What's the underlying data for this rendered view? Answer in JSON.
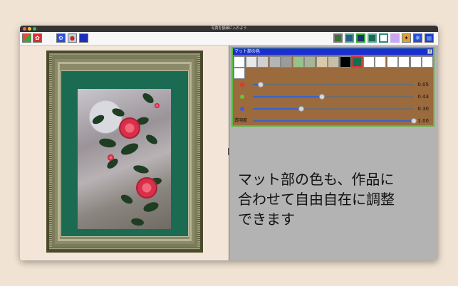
{
  "window": {
    "title": "写真を額縁に入れよう"
  },
  "toolbar": {
    "left_icons": [
      "photo-collage-icon",
      "camellia-icon",
      "gear-icon",
      "ladybug-jar-icon",
      "frame-blue-icon"
    ],
    "right_icons": [
      "frame-green-icon",
      "frame-blue-square-icon",
      "frame-navy-icon",
      "frame-teal-icon",
      "frame-outline-icon",
      "lavender-swatch-icon",
      "star-photo-icon",
      "blue-pattern-icon",
      "blue-mosaic-icon"
    ]
  },
  "mat_panel": {
    "title": "マット部の色",
    "close_label": "×",
    "swatches": [
      "#ffffff",
      "#e8e8e8",
      "#d0d0d0",
      "#b5b5b5",
      "#9b9b9b",
      "#9bc18b",
      "#a6b596",
      "#d9c9a8",
      "#c9bfa5",
      "#000000",
      "#1b6b53",
      "#ffffff",
      "#ffffff",
      "#ffffff",
      "#ffffff",
      "#ffffff",
      "#ffffff",
      "#ffffff"
    ],
    "sliders": [
      {
        "label": "",
        "color": "#d93a2b",
        "value": 0.05,
        "display": "0.05"
      },
      {
        "label": "",
        "color": "#6bc23a",
        "value": 0.43,
        "display": "0.43"
      },
      {
        "label": "",
        "color": "#4a5bd0",
        "value": 0.3,
        "display": "0.30"
      },
      {
        "label": "透明度",
        "color": "",
        "value": 1.0,
        "display": "1.00"
      }
    ]
  },
  "caption": {
    "line1": "マット部の色も、作品に",
    "line2": "合わせて自由自在に調整",
    "line3": "できます"
  }
}
